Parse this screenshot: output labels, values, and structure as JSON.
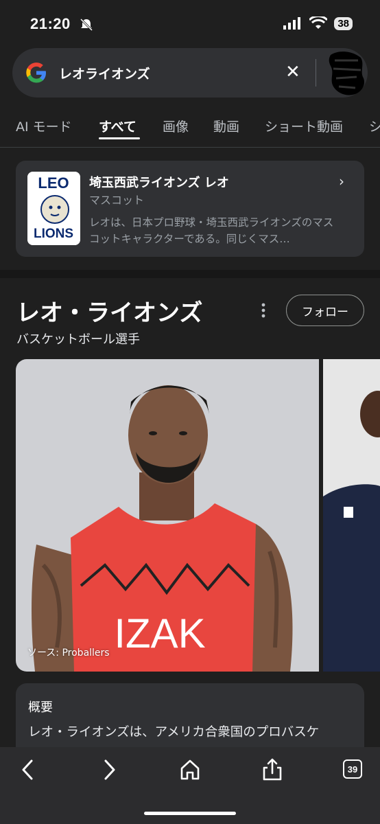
{
  "status": {
    "time": "21:20",
    "battery": "38"
  },
  "search": {
    "query": "レオライオンズ"
  },
  "tabs": [
    {
      "label": "AI モード"
    },
    {
      "label": "すべて"
    },
    {
      "label": "画像"
    },
    {
      "label": "動画"
    },
    {
      "label": "ショート動画"
    },
    {
      "label": "シ"
    }
  ],
  "entity": {
    "title": "埼玉西武ライオンズ レオ",
    "subtitle": "マスコット",
    "description": "レオは、日本プロ野球・埼玉西武ライオンズのマスコットキャラクターである。同じくマス…",
    "logo_top": "LEO",
    "logo_bottom": "LIONS"
  },
  "panel": {
    "title": "レオ・ライオンズ",
    "subtitle": "バスケットボール選手",
    "follow_label": "フォロー",
    "photo_source": "ソース: Proballers",
    "jersey_text": "IZAK"
  },
  "overview": {
    "title": "概要",
    "text": "レオ・ライオンズは、アメリカ合衆国のプロバスケ"
  },
  "toolbar": {
    "tabs_count": "39"
  },
  "colors": {
    "background": "#1f1f1f",
    "card": "#303134",
    "jersey": "#e8463f"
  }
}
